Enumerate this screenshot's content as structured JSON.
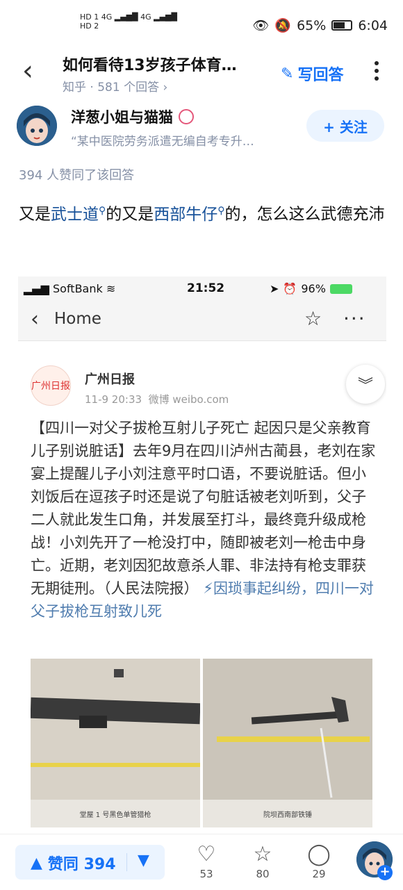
{
  "status_bar": {
    "left_row1": "HD 1  4G ▂▄▆█  4G ▂▄▆█",
    "left_row2": "HD 2",
    "battery_text": "65%",
    "battery_level": 0.65,
    "time": "6:04"
  },
  "header": {
    "question_title": "如何看待13岁孩子体育…",
    "source": "知乎",
    "answer_count": "581 个回答",
    "write_answer_label": "写回答"
  },
  "author": {
    "name": "洋葱小姐与猫猫",
    "bio": "“某中医院劳务派遣无编自考专升…",
    "follow_label": "+ 关注"
  },
  "answer": {
    "likes_line": "394 人赞同了该回答",
    "text_part1": "又是",
    "keyword1": "武士道",
    "text_part2": "的又是",
    "keyword2": "西部牛仔",
    "text_part3": "的，怎么这么武德充沛"
  },
  "embedded": {
    "carrier": "SoftBank",
    "time": "21:52",
    "battery_text": "96%",
    "nav_back_label": "Home",
    "account_name": "广州日报",
    "post_time": "11-9 20:33",
    "post_via": "微博 weibo.com",
    "post_text": "【四川一对父子拔枪互射儿子死亡 起因只是父亲教育儿子别说脏话】去年9月在四川泸州古蔺县，老刘在家宴上提醒儿子小刘注意平时口语，不要说脏话。但小刘饭后在逗孩子时还是说了句脏话被老刘听到，父子二人就此发生口角，并发展至打斗，最终竟升级成枪战！小刘先开了一枪没打中，随即被老刘一枪击中身亡。近期，老刘因犯故意杀人罪、非法持有枪支罪获无期徒刑。（人民法院报）",
    "post_link": "因琐事起纠纷，四川一对父子拔枪互射致儿死",
    "photo1_caption": "堂屋 1 号黑色单管猎枪",
    "photo2_caption": "院坝西南部铁锤",
    "logo_text": "广州日报"
  },
  "bottom": {
    "vote_up_label": "赞同 394",
    "comments": "53",
    "favorites": "80",
    "shares": "29"
  }
}
